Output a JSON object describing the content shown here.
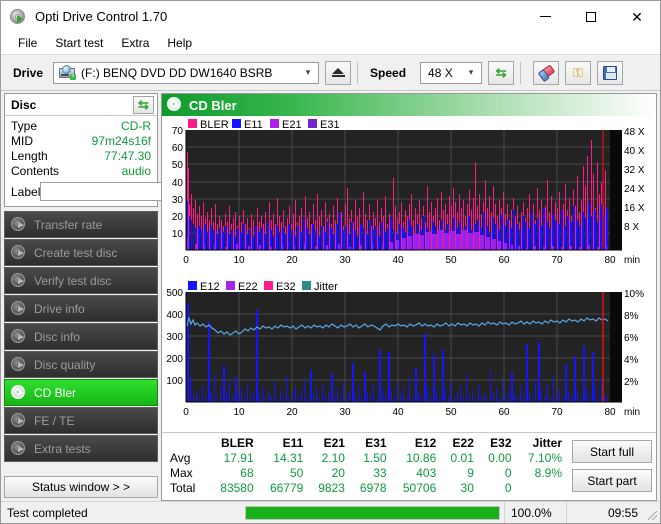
{
  "window": {
    "title": "Opti Drive Control 1.70",
    "icon": "disc-icon",
    "minimize_label": "—",
    "maximize_label": "□",
    "close_label": "✕"
  },
  "menu": {
    "items": [
      {
        "label": "File"
      },
      {
        "label": "Start test"
      },
      {
        "label": "Extra"
      },
      {
        "label": "Help"
      }
    ]
  },
  "toolbar": {
    "drive_label": "Drive",
    "drive_value": "(F:)   BENQ DVD DD DW1640 BSRB",
    "drive_icon": "optical-drive-icon",
    "eject_label": "eject-icon",
    "speed_label": "Speed",
    "speed_value": "48 X",
    "refresh_icon": "refresh-icon",
    "erase_icon": "eraser-icon",
    "keys_icon": "keys-icon",
    "save_icon": "floppy-save-icon"
  },
  "sidebar": {
    "disc_panel": {
      "title": "Disc",
      "refresh_icon": "refresh-icon",
      "rows": [
        {
          "key": "Type",
          "value": "CD-R"
        },
        {
          "key": "MID",
          "value": "97m24s16f"
        },
        {
          "key": "Length",
          "value": "77:47.30"
        },
        {
          "key": "Contents",
          "value": "audio"
        }
      ],
      "label_key": "Label",
      "label_value": "",
      "label_placeholder": "",
      "label_button_icon": "cd-icon"
    },
    "nav": [
      {
        "label": "Transfer rate",
        "icon": "disc-icon",
        "active": false
      },
      {
        "label": "Create test disc",
        "icon": "disc-icon",
        "active": false
      },
      {
        "label": "Verify test disc",
        "icon": "disc-icon",
        "active": false
      },
      {
        "label": "Drive info",
        "icon": "disc-icon",
        "active": false
      },
      {
        "label": "Disc info",
        "icon": "disc-icon",
        "active": false
      },
      {
        "label": "Disc quality",
        "icon": "disc-icon",
        "active": false
      },
      {
        "label": "CD Bler",
        "icon": "disc-icon",
        "active": true
      },
      {
        "label": "FE / TE",
        "icon": "disc-icon",
        "active": false
      },
      {
        "label": "Extra tests",
        "icon": "disc-icon",
        "active": false
      }
    ],
    "status_window_button": "Status window > >"
  },
  "main": {
    "panel_title": "CD Bler",
    "panel_icon": "disc-icon",
    "start_full_label": "Start full",
    "start_part_label": "Start part"
  },
  "stats": {
    "columns": [
      "BLER",
      "E11",
      "E21",
      "E31",
      "E12",
      "E22",
      "E32",
      "Jitter"
    ],
    "rows": [
      {
        "name": "Avg",
        "values": [
          "17.91",
          "14.31",
          "2.10",
          "1.50",
          "10.86",
          "0.01",
          "0.00",
          "7.10%"
        ]
      },
      {
        "name": "Max",
        "values": [
          "68",
          "50",
          "20",
          "33",
          "403",
          "9",
          "0",
          "8.9%"
        ]
      },
      {
        "name": "Total",
        "values": [
          "83580",
          "66779",
          "9823",
          "6978",
          "50706",
          "30",
          "0",
          ""
        ]
      }
    ]
  },
  "statusbar": {
    "message": "Test completed",
    "progress_percent": 100.0,
    "progress_label": "100.0%",
    "elapsed": "09:55"
  },
  "chart_data": [
    {
      "type": "area",
      "id": "bler-chart",
      "title": "CD Bler errors",
      "xlabel": "min",
      "ylabel": "",
      "xlim": [
        0,
        80
      ],
      "ylim": [
        0,
        70
      ],
      "yticks": [
        10,
        20,
        30,
        40,
        50,
        60,
        70
      ],
      "xticks": [
        0,
        10,
        20,
        30,
        40,
        50,
        60,
        70,
        80
      ],
      "xtick_suffix": "min",
      "right_axis": {
        "label": "X",
        "ticks": [
          "8 X",
          "16 X",
          "24 X",
          "32 X",
          "40 X",
          "48 X"
        ],
        "lim": [
          0,
          52
        ]
      },
      "grid": true,
      "legend_position": "top-left",
      "background": "#222222",
      "legend": [
        {
          "name": "BLER",
          "color": "#ff1a8c"
        },
        {
          "name": "E11",
          "color": "#1414ff"
        },
        {
          "name": "E21",
          "color": "#aa22ee"
        },
        {
          "name": "E31",
          "color": "#7722cc"
        }
      ],
      "series": [
        {
          "name": "BLER",
          "color": "#ff1a8c",
          "avg": 17.91,
          "max": 68,
          "total": 83580
        },
        {
          "name": "E11",
          "color": "#1414ff",
          "avg": 14.31,
          "max": 50,
          "total": 66779
        },
        {
          "name": "E21",
          "color": "#aa22ee",
          "avg": 2.1,
          "max": 20,
          "total": 9823
        },
        {
          "name": "E31",
          "color": "#7722cc",
          "avg": 1.5,
          "max": 33,
          "total": 6978
        }
      ],
      "red_marker_x": 78.5,
      "notes": "Dense per-sample spikes over 0-80 min; BLER (pink) peaks up to ~68 near 0 min and ~44 at 27 min; E11 (blue) forms base band 5-25; E21/E31 (violet) concentrated 40-55 min."
    },
    {
      "type": "area",
      "id": "e12-jitter-chart",
      "title": "E12 / E22 / E32 / Jitter",
      "xlabel": "min",
      "ylabel": "",
      "xlim": [
        0,
        80
      ],
      "ylim": [
        0,
        500
      ],
      "yticks": [
        100,
        200,
        300,
        400,
        500
      ],
      "xticks": [
        0,
        10,
        20,
        30,
        40,
        50,
        60,
        70,
        80
      ],
      "xtick_suffix": "min",
      "right_axis": {
        "label": "%",
        "ticks": [
          "2%",
          "4%",
          "6%",
          "8%",
          "10%"
        ],
        "lim": [
          0,
          10
        ]
      },
      "grid": true,
      "legend_position": "top-left",
      "background": "#222222",
      "legend": [
        {
          "name": "E12",
          "color": "#1414ff"
        },
        {
          "name": "E22",
          "color": "#aa22ee"
        },
        {
          "name": "E32",
          "color": "#ff1a8c"
        },
        {
          "name": "Jitter",
          "color": "#2d8f84"
        }
      ],
      "series": [
        {
          "name": "E12",
          "color": "#1414ff",
          "avg": 10.86,
          "max": 403,
          "total": 50706
        },
        {
          "name": "E22",
          "color": "#aa22ee",
          "avg": 0.01,
          "max": 9,
          "total": 30
        },
        {
          "name": "E32",
          "color": "#ff1a8c",
          "avg": 0.0,
          "max": 0,
          "total": 0
        },
        {
          "name": "Jitter",
          "color": "#5aa8e8",
          "avg": 7.1,
          "max": 8.9,
          "unit": "%"
        }
      ],
      "red_marker_x": 78.5,
      "notes": "Jitter trace (light blue line) sits ~7.0-7.3% (about 350 on left scale) across the disc, rising slightly to ~8% after 70 min. E12 spikes (blue) reach 403 near 0 min, with tall spikes at 4, 11, 26, 36 and 59 min."
    }
  ]
}
